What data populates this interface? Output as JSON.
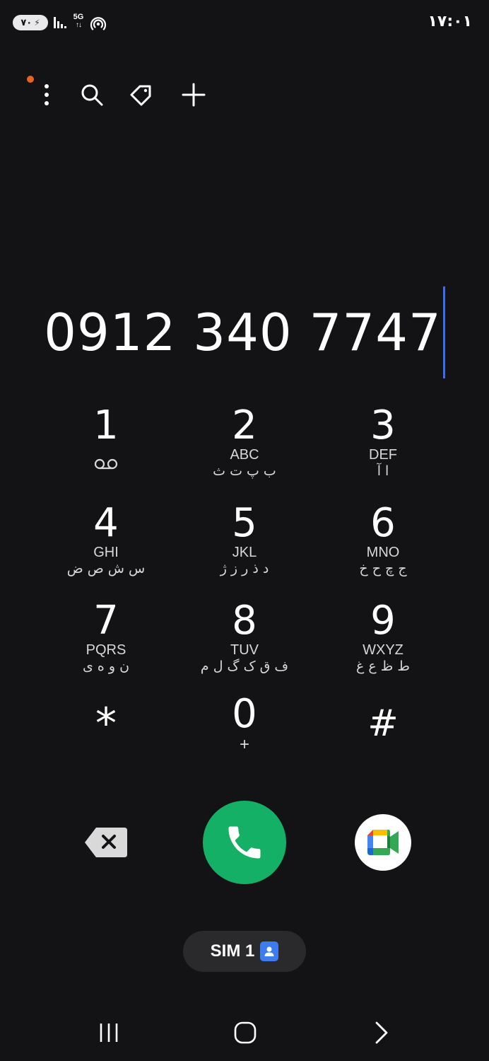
{
  "status_bar": {
    "battery_text": "۷۰",
    "network": "5G",
    "network_arrows": "↑↓",
    "time": "۱۷:۰۱"
  },
  "toolbar": {
    "icons": [
      "more-options-icon",
      "search-icon",
      "tag-icon",
      "add-icon"
    ],
    "has_notification": true
  },
  "dialer": {
    "number": "0912 340 7747"
  },
  "keypad": [
    {
      "digit": "1",
      "letters": "",
      "fa": "",
      "sub_icon": "voicemail-icon"
    },
    {
      "digit": "2",
      "letters": "ABC",
      "fa": "ب پ ت ث"
    },
    {
      "digit": "3",
      "letters": "DEF",
      "fa": "ا آ"
    },
    {
      "digit": "4",
      "letters": "GHI",
      "fa": "س ش ص ض"
    },
    {
      "digit": "5",
      "letters": "JKL",
      "fa": "د ذ ر ز ژ"
    },
    {
      "digit": "6",
      "letters": "MNO",
      "fa": "ج چ ح خ"
    },
    {
      "digit": "7",
      "letters": "PQRS",
      "fa": "ن و ه ی"
    },
    {
      "digit": "8",
      "letters": "TUV",
      "fa": "ف ق ک گ ل م"
    },
    {
      "digit": "9",
      "letters": "WXYZ",
      "fa": "ط ظ ع غ"
    },
    {
      "digit": "*",
      "letters": "",
      "fa": ""
    },
    {
      "digit": "0",
      "letters": "",
      "fa": "",
      "sub": "+"
    },
    {
      "digit": "#",
      "letters": "",
      "fa": ""
    }
  ],
  "actions": {
    "backspace_icon": "backspace-icon",
    "call_icon": "phone-icon",
    "video_icon": "google-meet-icon",
    "call_color": "#14b065"
  },
  "sim": {
    "label": "SIM 1",
    "icon": "contact-card-icon",
    "icon_color": "#3d7cf0"
  },
  "nav": {
    "icons": [
      "recent-apps-icon",
      "home-icon",
      "back-icon"
    ]
  }
}
